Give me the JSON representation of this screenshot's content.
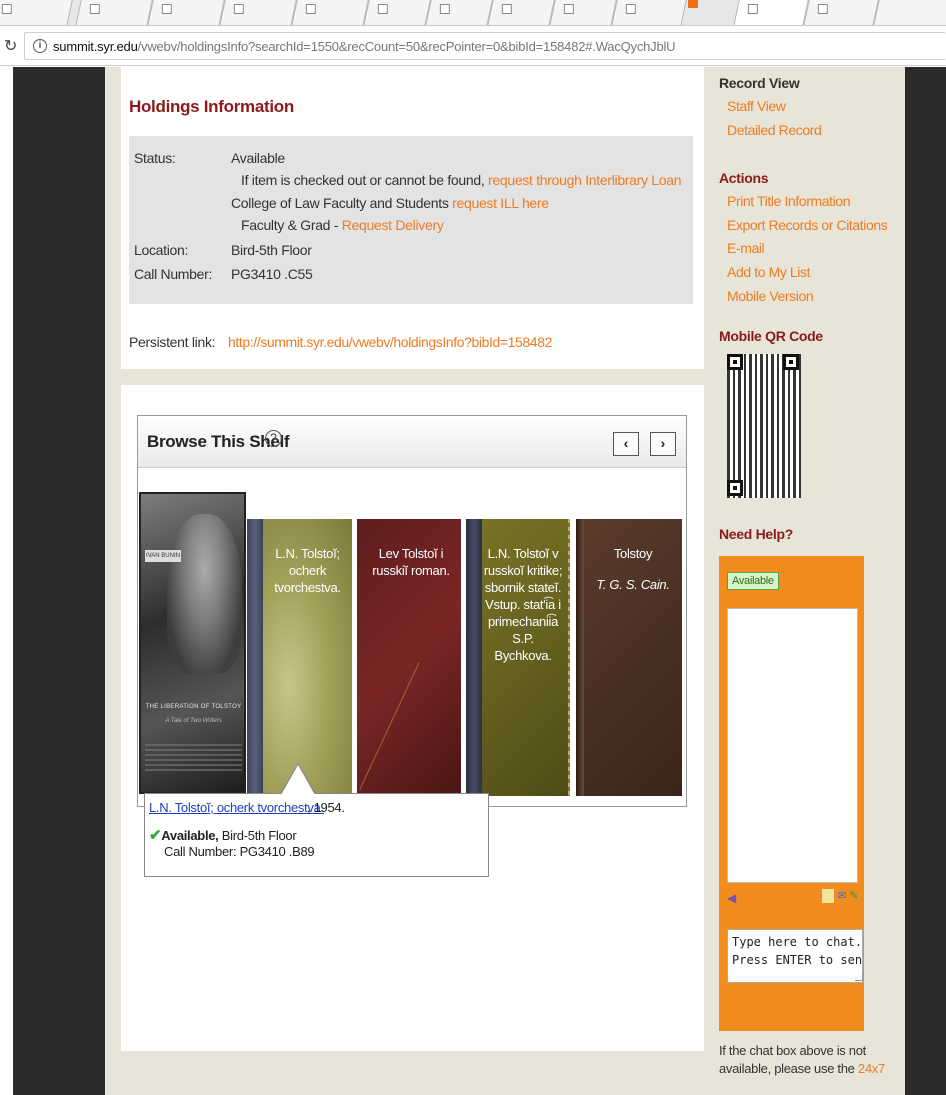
{
  "browser": {
    "url_host": "summit.syr.edu",
    "url_path": "/vwebv/holdingsInfo?searchId=1550&recCount=50&recPointer=0&bibId=158482#.WacQychJblU"
  },
  "holdings": {
    "title": "Holdings Information",
    "status_label": "Status:",
    "status_value": "Available",
    "ill_text": "If item is checked out or cannot be found, ",
    "ill_link": "request through Interlibrary Loan",
    "law_text": "College of Law Faculty and Students ",
    "law_link": "request ILL here",
    "grad_text": "Faculty & Grad - ",
    "grad_link": "Request Delivery",
    "location_label": "Location:",
    "location_value": "Bird-5th Floor",
    "call_label": "Call Number:",
    "call_value": "PG3410 .C55",
    "persistent_label": "Persistent link:",
    "persistent_url": "http://summit.syr.edu/vwebv/holdingsInfo?bibId=158482"
  },
  "shelf": {
    "title": "Browse This Shelf",
    "help_glyph": "?",
    "prev_glyph": "‹",
    "next_glyph": "›",
    "books": [
      {
        "cover_author": "IVAN BUNIN",
        "cover_title": "THE LIBERATION OF TOLSTOY",
        "cover_subtitle": "A Tale of Two Writers"
      },
      {
        "title": "L.N. Tolstoĭ; ocherk tvorchestva.",
        "author": ""
      },
      {
        "title": "Lev Tolstoĭ i russkiĭ roman.",
        "author": ""
      },
      {
        "title": "L.N. Tolstoĭ v russkoĭ kritike; sbornik stateĭ. Vstup. statʹi͡a i primechanii͡a S.P. Bychkova.",
        "author": ""
      },
      {
        "title": "Tolstoy",
        "author": "T. G. S. Cain."
      }
    ],
    "popup": {
      "link": "L.N. Tolstoĭ; ocherk tvorchestva.",
      "year": ", 1954.",
      "status": "Available,",
      "location": " Bird-5th Floor",
      "call": "Call Number: PG3410 .B89"
    }
  },
  "sidebar": {
    "record_view": "Record View",
    "staff_view": "Staff View",
    "detailed_record": "Detailed Record",
    "actions_title": "Actions",
    "actions": [
      "Print Title Information",
      "Export Records or Citations",
      "E-mail",
      "Add to My List",
      "Mobile Version"
    ],
    "qr_title": "Mobile QR Code",
    "help_title": "Need Help?",
    "chat_status": "Available",
    "chat_placeholder": "Type here to chat.\nPress ENTER to send.",
    "chat_note": "If the chat box above is not available, please use the ",
    "chat_note_link": "24x7"
  }
}
